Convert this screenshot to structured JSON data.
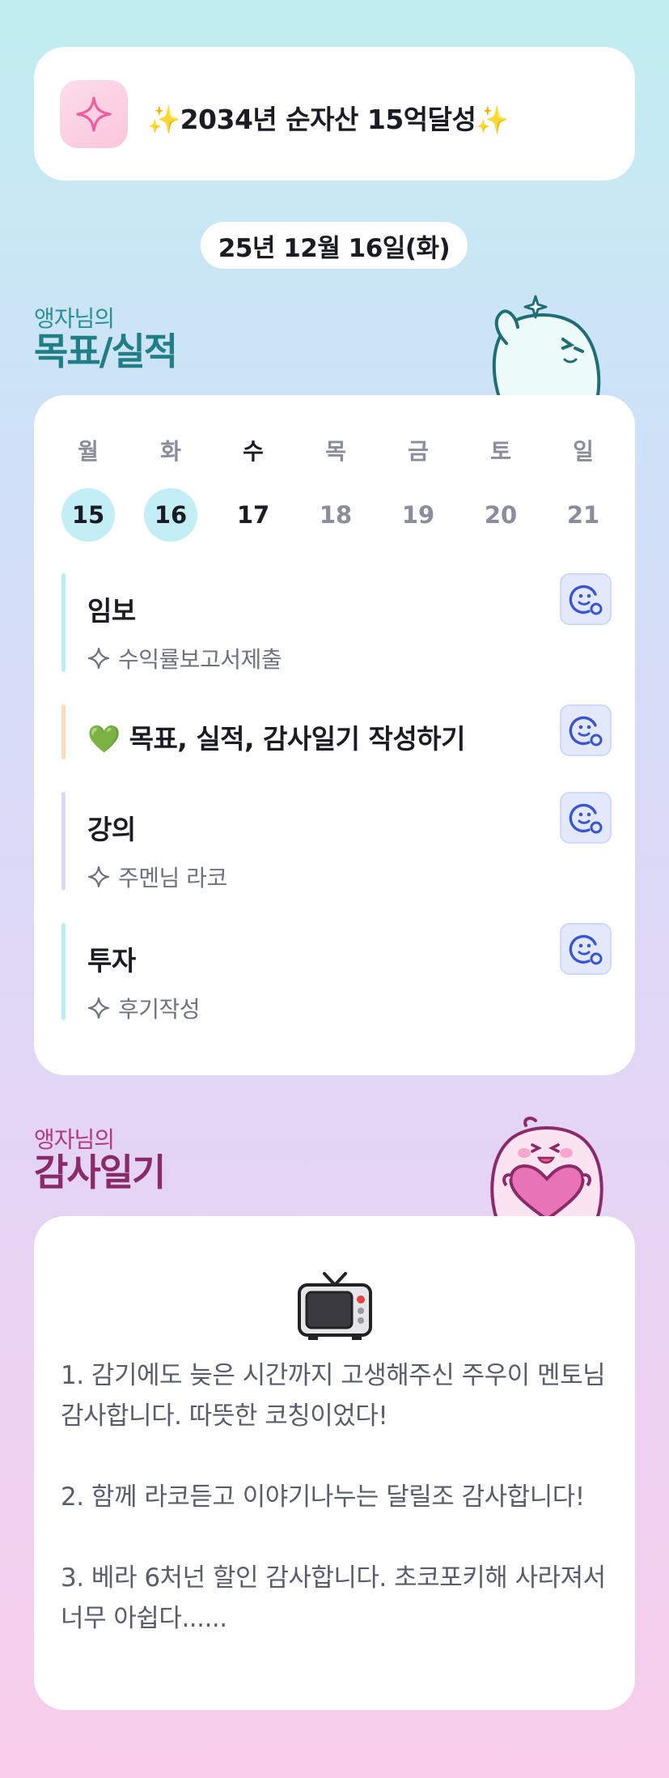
{
  "goal": {
    "text": "✨2034년 순자산 15억달성✨"
  },
  "date": "25년 12월 16일(화)",
  "goals_section": {
    "owner": "앵자님의",
    "title": "목표/실적"
  },
  "week": {
    "days": [
      {
        "name": "월",
        "num": "15"
      },
      {
        "name": "화",
        "num": "16"
      },
      {
        "name": "수",
        "num": "17"
      },
      {
        "name": "목",
        "num": "18"
      },
      {
        "name": "금",
        "num": "19"
      },
      {
        "name": "토",
        "num": "20"
      },
      {
        "name": "일",
        "num": "21"
      }
    ]
  },
  "tasks": [
    {
      "title": "임보",
      "sub": "수익률보고서제출"
    },
    {
      "title": "💚 목표, 실적, 감사일기 작성하기"
    },
    {
      "title": "강의",
      "sub": "주멘님 라코"
    },
    {
      "title": "투자",
      "sub": "후기작성"
    }
  ],
  "gratitude_section": {
    "owner": "앵자님의",
    "title": "감사일기"
  },
  "gratitude": {
    "entries": [
      "1. 감기에도 늦은 시간까지 고생해주신 주우이 멘토님 감사합니다. 따뜻한 코칭이었다!",
      "2. 함께 라코듣고 이야기나누는 달릴조 감사합니다!",
      "3. 베라 6처넌 할인 감사합니다. 초코포키해 사라져서 너무 아쉽다......"
    ]
  },
  "colors": {
    "accent_teal": "#1f7e86",
    "accent_purple": "#8b2a6a",
    "today_bg": "#c4eef5"
  }
}
